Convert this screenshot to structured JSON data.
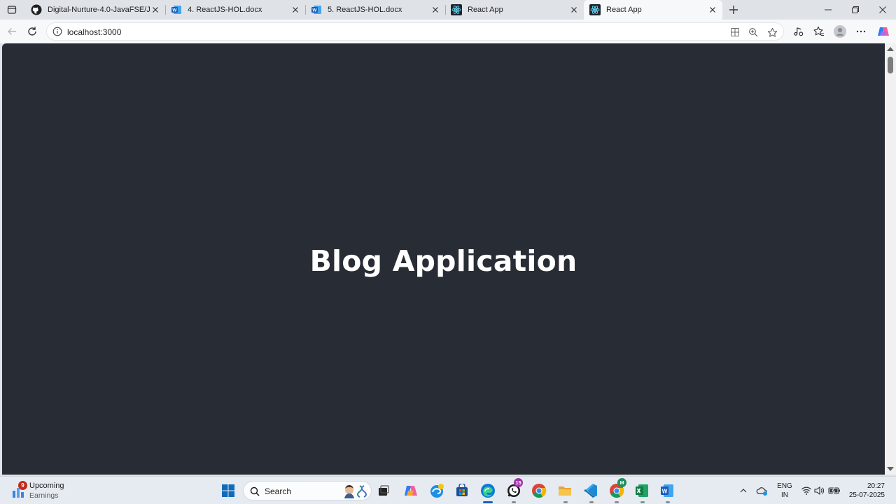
{
  "browser": {
    "tabs": [
      {
        "title": "Digital-Nurture-4.0-JavaFSE/Java",
        "icon": "github-icon"
      },
      {
        "title": "4. ReactJS-HOL.docx",
        "icon": "word-icon"
      },
      {
        "title": "5. ReactJS-HOL.docx",
        "icon": "word-icon"
      },
      {
        "title": "React App",
        "icon": "react-icon"
      },
      {
        "title": "React App",
        "icon": "react-icon",
        "active": true
      }
    ],
    "url": "localhost:3000"
  },
  "page": {
    "heading": "Blog Application",
    "background": "#282c34",
    "text_color": "#ffffff"
  },
  "taskbar": {
    "weather": {
      "title": "Upcoming",
      "subtitle": "Earnings",
      "badge": "9"
    },
    "search_placeholder": "Search",
    "whatsapp_badge": "15",
    "chrome_profile_badge": "M",
    "language": {
      "line1": "ENG",
      "line2": "IN"
    },
    "time": "20:27",
    "date": "25-07-2025"
  }
}
